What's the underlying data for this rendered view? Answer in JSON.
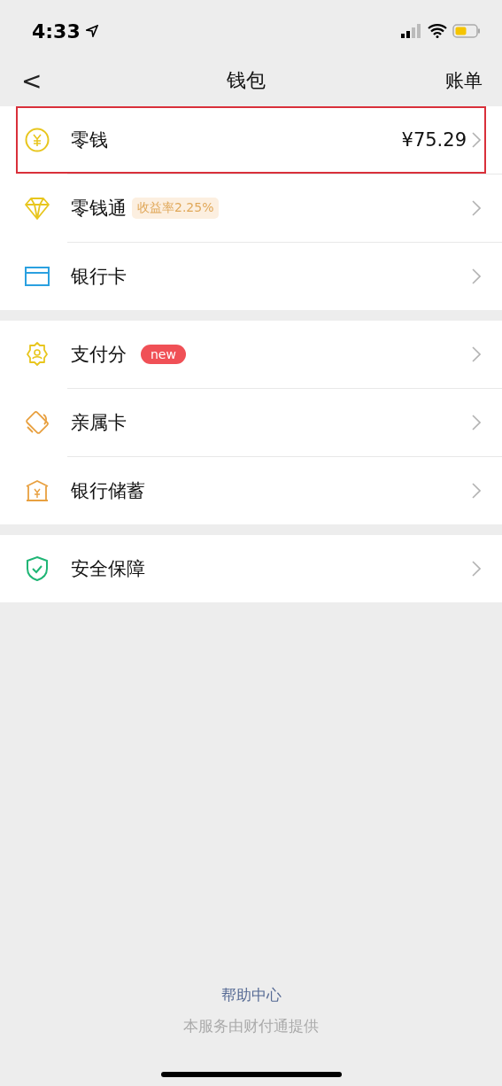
{
  "status_bar": {
    "time": "4:33"
  },
  "nav": {
    "back": "<",
    "title": "钱包",
    "action": "账单"
  },
  "groups": [
    {
      "items": [
        {
          "label": "零钱",
          "value": "¥75.29",
          "highlighted": true
        },
        {
          "label": "零钱通",
          "badge": {
            "kind": "rate",
            "text": "收益率2.25%"
          },
          "highlighted": false
        },
        {
          "label": "银行卡",
          "highlighted": false
        }
      ]
    },
    {
      "items": [
        {
          "label": "支付分",
          "badge": {
            "kind": "new",
            "text": "new"
          },
          "highlighted": false
        },
        {
          "label": "亲属卡",
          "highlighted": false
        },
        {
          "label": "银行储蓄",
          "highlighted": false
        }
      ]
    },
    {
      "items": [
        {
          "label": "安全保障",
          "highlighted": false
        }
      ]
    }
  ],
  "footer": {
    "link": "帮助中心",
    "note": "本服务由财付通提供"
  }
}
